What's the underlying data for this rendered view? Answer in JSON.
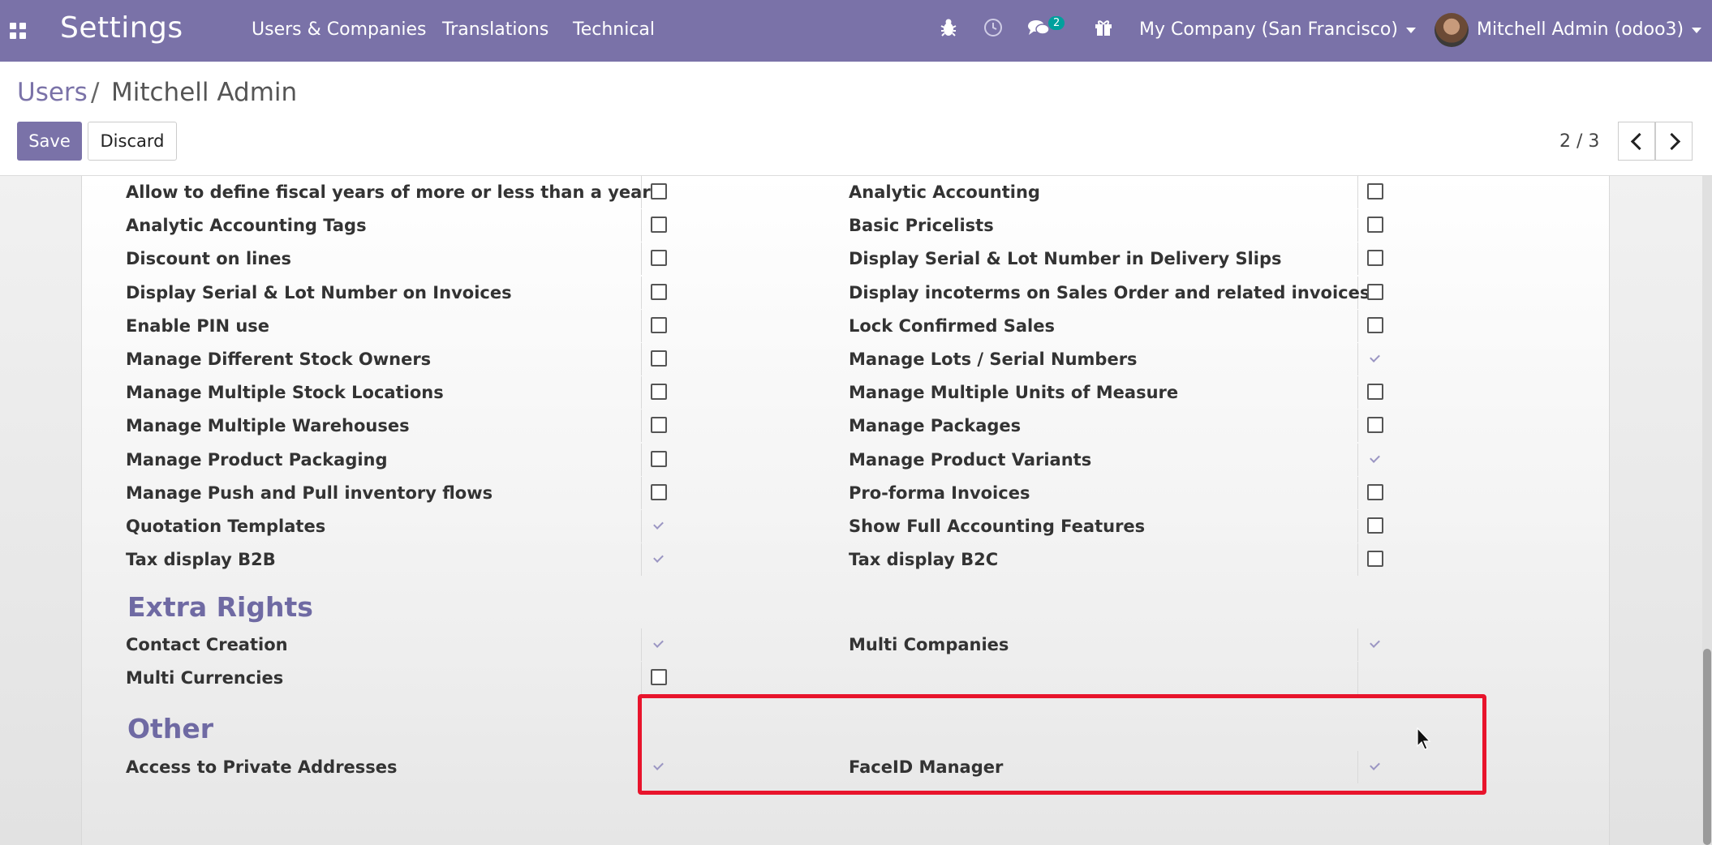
{
  "navbar": {
    "brand": "Settings",
    "menu": [
      "Users & Companies",
      "Translations",
      "Technical"
    ],
    "chat_badge": "2",
    "company": "My Company (San Francisco)",
    "user": "Mitchell Admin (odoo3)",
    "accent_color": "#7a72a8"
  },
  "breadcrumb": {
    "parent": "Users",
    "separator": "/",
    "current": "Mitchell Admin"
  },
  "buttons": {
    "save": "Save",
    "discard": "Discard"
  },
  "pager": {
    "value": "2 / 3"
  },
  "rows": [
    {
      "left": "Allow to define fiscal years of more or less than a year",
      "left_checked": false,
      "right": "Analytic Accounting",
      "right_checked": false
    },
    {
      "left": "Analytic Accounting Tags",
      "left_checked": false,
      "right": "Basic Pricelists",
      "right_checked": false
    },
    {
      "left": "Discount on lines",
      "left_checked": false,
      "right": "Display Serial & Lot Number in Delivery Slips",
      "right_checked": false
    },
    {
      "left": "Display Serial & Lot Number on Invoices",
      "left_checked": false,
      "right": "Display incoterms on Sales Order and related invoices",
      "right_checked": false
    },
    {
      "left": "Enable PIN use",
      "left_checked": false,
      "right": "Lock Confirmed Sales",
      "right_checked": false
    },
    {
      "left": "Manage Different Stock Owners",
      "left_checked": false,
      "right": "Manage Lots / Serial Numbers",
      "right_checked": true
    },
    {
      "left": "Manage Multiple Stock Locations",
      "left_checked": false,
      "right": "Manage Multiple Units of Measure",
      "right_checked": false
    },
    {
      "left": "Manage Multiple Warehouses",
      "left_checked": false,
      "right": "Manage Packages",
      "right_checked": false
    },
    {
      "left": "Manage Product Packaging",
      "left_checked": false,
      "right": "Manage Product Variants",
      "right_checked": true
    },
    {
      "left": "Manage Push and Pull inventory flows",
      "left_checked": false,
      "right": "Pro-forma Invoices",
      "right_checked": false
    },
    {
      "left": "Quotation Templates",
      "left_checked": true,
      "right": "Show Full Accounting Features",
      "right_checked": false
    },
    {
      "left": "Tax display B2B",
      "left_checked": true,
      "right": "Tax display B2C",
      "right_checked": false
    }
  ],
  "extra_rights": {
    "title": "Extra Rights",
    "rows": [
      {
        "left": "Contact Creation",
        "left_checked": true,
        "right": "Multi Companies",
        "right_checked": true
      },
      {
        "left": "Multi Currencies",
        "left_checked": false,
        "right": null,
        "right_checked": null
      }
    ]
  },
  "other": {
    "title": "Other",
    "rows": [
      {
        "left": "Access to Private Addresses",
        "left_checked": true,
        "right": "FaceID Manager",
        "right_checked": true
      }
    ]
  },
  "highlight_color": "#e8142c"
}
